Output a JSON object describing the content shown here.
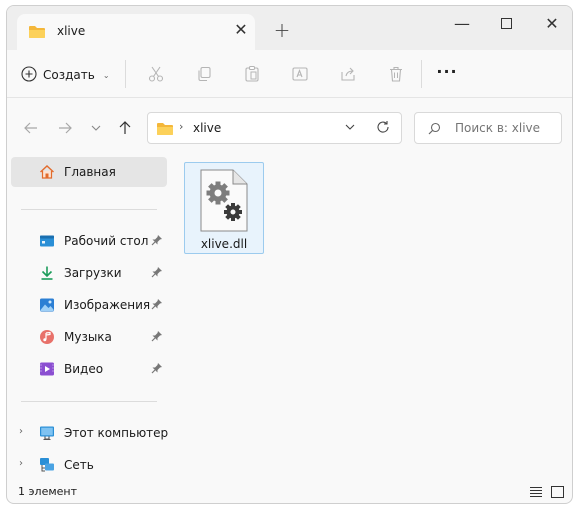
{
  "window": {
    "tab_title": "xlive",
    "tab_close": "✕",
    "new_tab": "+",
    "minimize": "—",
    "close": "✕"
  },
  "toolbar": {
    "create_label": "Создать",
    "create_caret": "⌄",
    "more": "···"
  },
  "address": {
    "chevron": "›",
    "path": "xlive"
  },
  "search": {
    "placeholder": "Поиск в: xlive"
  },
  "sidebar": {
    "home": "Главная",
    "quick_access": [
      {
        "label": "Рабочий стол",
        "icon": "desktop-icon"
      },
      {
        "label": "Загрузки",
        "icon": "downloads-icon"
      },
      {
        "label": "Изображения",
        "icon": "pictures-icon"
      },
      {
        "label": "Музыка",
        "icon": "music-icon"
      },
      {
        "label": "Видео",
        "icon": "videos-icon"
      }
    ],
    "expander": "›",
    "this_pc": "Этот компьютер",
    "network": "Сеть"
  },
  "files": [
    {
      "name": "xlive.dll",
      "icon": "dll-file-icon",
      "selected": true
    }
  ],
  "status": {
    "count": "1 элемент"
  },
  "colors": {
    "accent": "#0067c0",
    "folder": "#f7c646",
    "selection_bg": "#e8f3fc",
    "selection_border": "#9ccbee"
  }
}
